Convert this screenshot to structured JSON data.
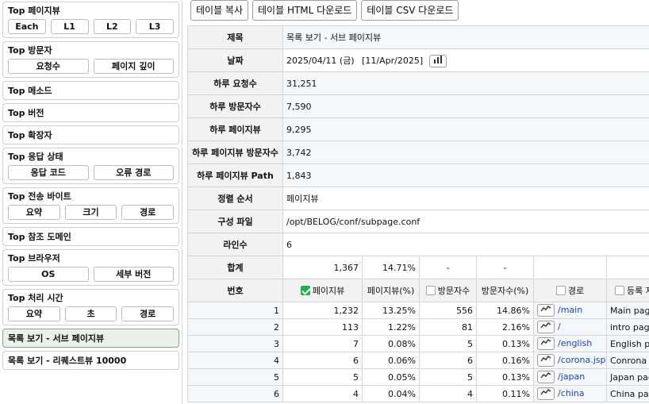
{
  "sidebar": {
    "groups": [
      {
        "title": "Top 페이지뷰",
        "buttons": [
          "Each",
          "L1",
          "L2",
          "L3"
        ]
      },
      {
        "title": "Top 방문자",
        "buttons": [
          "요청수",
          "페이지 깊이"
        ]
      },
      {
        "title": "Top 메소드",
        "buttons": []
      },
      {
        "title": "Top 버전",
        "buttons": []
      },
      {
        "title": "Top 확장자",
        "buttons": []
      },
      {
        "title": "Top 응답 상태",
        "buttons": [
          "응답 코드",
          "오류 경로"
        ]
      },
      {
        "title": "Top 전송 바이트",
        "buttons": [
          "요약",
          "크기",
          "경로"
        ]
      },
      {
        "title": "Top 참조 도메인",
        "buttons": []
      },
      {
        "title": "Top 브라우저",
        "buttons": [
          "OS",
          "세부 버전"
        ]
      },
      {
        "title": "Top 처리 시간",
        "buttons": [
          "요약",
          "초",
          "경로"
        ]
      },
      {
        "title": "목록 보기 - 서브 페이지뷰",
        "buttons": [],
        "active": true
      },
      {
        "title": "목록 보기 - 리퀘스트뷰 10000",
        "buttons": []
      }
    ]
  },
  "toolbar": {
    "copy_label": "테이블 복사",
    "html_label": "테이블 HTML 다운로드",
    "csv_label": "테이블 CSV 다운로드"
  },
  "info": {
    "title_label": "제목",
    "title_value": "목록 보기 - 서브 페이지뷰",
    "date_label": "날짜",
    "date_value": "2025/04/11 (금)",
    "date_alt": "[11/Apr/2025]",
    "daily_requests_label": "하루 요청수",
    "daily_requests_value": "31,251",
    "daily_visitors_label": "하루 방문자수",
    "daily_visitors_value": "7,590",
    "daily_pageviews_label": "하루 페이지뷰",
    "daily_pageviews_value": "9,295",
    "daily_pv_visitors_label": "하루 페이지뷰 방문자수",
    "daily_pv_visitors_value": "3,742",
    "daily_pv_path_label": "하루 페이지뷰 Path",
    "daily_pv_path_value": "1,843",
    "sort_label": "정렬 순서",
    "sort_value": "페이지뷰",
    "config_label": "구성 파일",
    "config_value": "/opt/BELOG/conf/subpage.conf",
    "lines_label": "라인수",
    "lines_value": "6"
  },
  "summary": {
    "label": "합계",
    "pageviews": "1,367",
    "pageviews_pct": "14.71%",
    "visitors": "-",
    "visitors_pct": "-"
  },
  "columns": {
    "no": "번호",
    "pageviews": "페이지뷰",
    "pageviews_pct": "페이지뷰(%)",
    "visitors": "방문자수",
    "visitors_pct": "방문자수(%)",
    "path": "경로",
    "title": "등록 제목"
  },
  "rows": [
    {
      "no": "1",
      "pv": "1,232",
      "pv_pct": "13.25%",
      "vis": "556",
      "vis_pct": "14.86%",
      "path": "/main",
      "title": "Main page"
    },
    {
      "no": "2",
      "pv": "113",
      "pv_pct": "1.22%",
      "vis": "81",
      "vis_pct": "2.16%",
      "path": "/",
      "title": "intro page"
    },
    {
      "no": "3",
      "pv": "7",
      "pv_pct": "0.08%",
      "vis": "5",
      "vis_pct": "0.13%",
      "path": "/english",
      "title": "English page"
    },
    {
      "no": "4",
      "pv": "6",
      "pv_pct": "0.06%",
      "vis": "6",
      "vis_pct": "0.16%",
      "path": "/corona.jsp",
      "title": "Conrona page"
    },
    {
      "no": "5",
      "pv": "5",
      "pv_pct": "0.05%",
      "vis": "5",
      "vis_pct": "0.13%",
      "path": "/japan",
      "title": "Japan page"
    },
    {
      "no": "6",
      "pv": "4",
      "pv_pct": "0.04%",
      "vis": "4",
      "vis_pct": "0.11%",
      "path": "/china",
      "title": "China page"
    }
  ],
  "colors": {
    "link": "#1a3fc4",
    "check": "#21b04c",
    "active_bg": "#eaf1ea"
  },
  "icons": {
    "date_chart": "bar-chart-icon",
    "row_trend": "trend-line-icon",
    "checkbox": "checkbox-icon"
  }
}
